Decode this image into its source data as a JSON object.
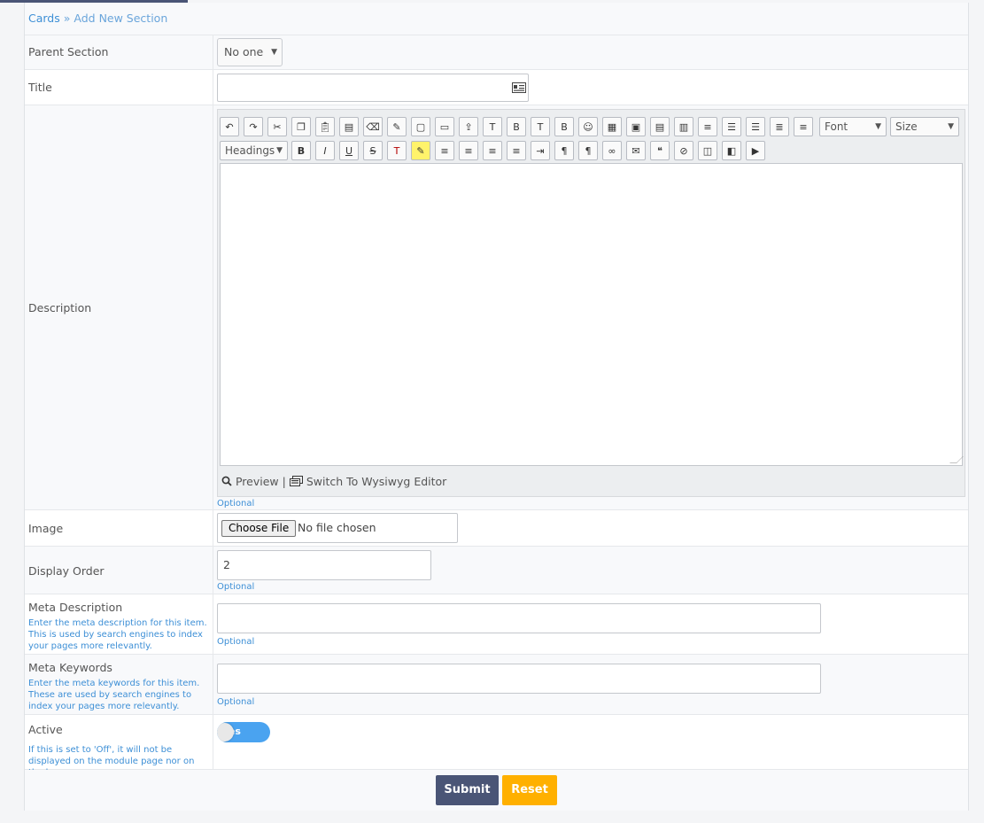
{
  "breadcrumb": {
    "root": "Cards",
    "sep": "»",
    "current": "Add New Section"
  },
  "fields": {
    "parent": {
      "label": "Parent Section",
      "value": "No one"
    },
    "title": {
      "label": "Title",
      "value": ""
    },
    "description": {
      "label": "Description",
      "optional": "Optional"
    },
    "image": {
      "label": "Image",
      "button": "Choose File",
      "status": "No file chosen"
    },
    "order": {
      "label": "Display Order",
      "value": "2",
      "optional": "Optional"
    },
    "meta_desc": {
      "label": "Meta Description",
      "help": "Enter the meta description for this item. This is used by search engines to index your pages more relevantly.",
      "value": "",
      "optional": "Optional"
    },
    "meta_keys": {
      "label": "Meta Keywords",
      "help": "Enter the meta keywords for this item. These are used by search engines to index your pages more relevantly.",
      "value": "",
      "optional": "Optional"
    },
    "active": {
      "label": "Active",
      "help": "If this is set to 'Off', it will not be displayed on the module page nor on the homepage.",
      "toggle": "Yes",
      "on": true
    }
  },
  "editor": {
    "font": "Font",
    "size": "Size",
    "headings": "Headings",
    "preview": "Preview",
    "separator": "|",
    "switch": "Switch To Wysiwyg Editor",
    "row1_icons": [
      "undo-icon",
      "redo-icon",
      "cut-icon",
      "copy-icon",
      "paste-icon",
      "paste-text-icon",
      "eraser-icon",
      "remove-format-icon",
      "select-all-icon",
      "image-icon",
      "image-upload-icon",
      "insert-text-before-icon",
      "insert-bbcode-before-icon",
      "insert-text-after-icon",
      "insert-bbcode-after-icon",
      "smiley-icon",
      "insert-date-icon",
      "code-icon",
      "php-icon",
      "html-icon",
      "ordered-list-icon",
      "unordered-list-icon",
      "bullet-list-icon",
      "numbered-list-icon",
      "nested-list-icon"
    ],
    "row2_icons": [
      "bold-icon",
      "italic-icon",
      "underline-icon",
      "strikethrough-icon",
      "text-color-icon",
      "highlight-icon",
      "align-left-icon",
      "align-center-icon",
      "align-right-icon",
      "justify-icon",
      "indent-icon",
      "ltr-icon",
      "rtl-icon",
      "link-icon",
      "email-icon",
      "quote-icon",
      "unlink-icon",
      "photo-icon",
      "gallery-icon",
      "video-icon"
    ]
  },
  "actions": {
    "submit": "Submit",
    "reset": "Reset"
  },
  "colors": {
    "accent": "#3d8fd6",
    "submit_bg": "#4a5576",
    "reset_bg": "#ffb000",
    "toggle_on": "#4aa3f0"
  }
}
